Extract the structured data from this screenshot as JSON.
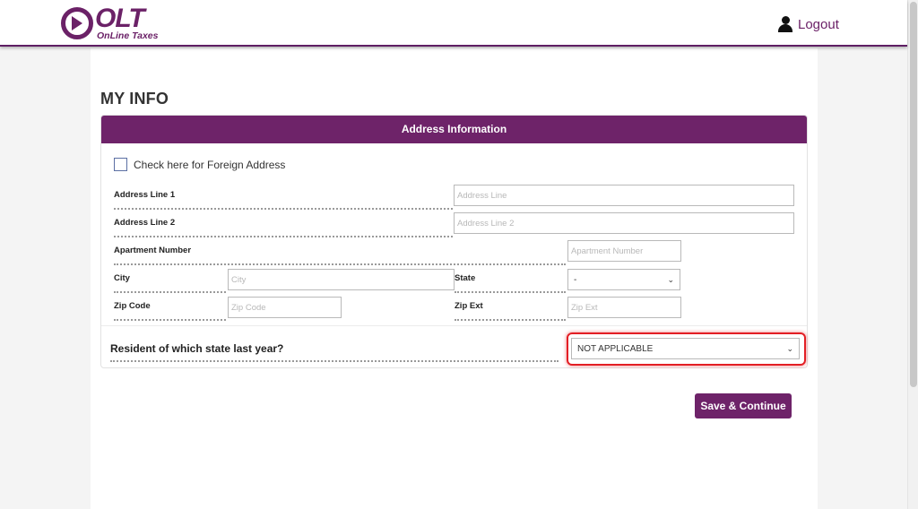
{
  "header": {
    "logo_text": "OLT",
    "logo_subtitle": "OnLine Taxes",
    "logout_label": "Logout"
  },
  "page": {
    "title": "MY INFO"
  },
  "panel": {
    "title": "Address Information",
    "foreign_address_label": "Check here for Foreign Address",
    "foreign_address_checked": false,
    "fields": {
      "address_line_1": {
        "label": "Address Line 1",
        "placeholder": "Address Line",
        "value": ""
      },
      "address_line_2": {
        "label": "Address Line 2",
        "placeholder": "Address Line 2",
        "value": ""
      },
      "apartment_number": {
        "label": "Apartment Number",
        "placeholder": "Apartment Number",
        "value": ""
      },
      "city": {
        "label": "City",
        "placeholder": "City",
        "value": ""
      },
      "state": {
        "label": "State",
        "selected": "-"
      },
      "zip_code": {
        "label": "Zip Code",
        "placeholder": "Zip Code",
        "value": ""
      },
      "zip_ext": {
        "label": "Zip Ext",
        "placeholder": "Zip Ext",
        "value": ""
      }
    },
    "resident": {
      "label": "Resident of which state last year?",
      "selected": "NOT APPLICABLE"
    }
  },
  "actions": {
    "save_label": "Save & Continue"
  },
  "colors": {
    "brand": "#6e2369",
    "highlight": "#e31e24"
  },
  "icons": {
    "user": "user-icon",
    "chevron": "chevron-down-icon"
  }
}
